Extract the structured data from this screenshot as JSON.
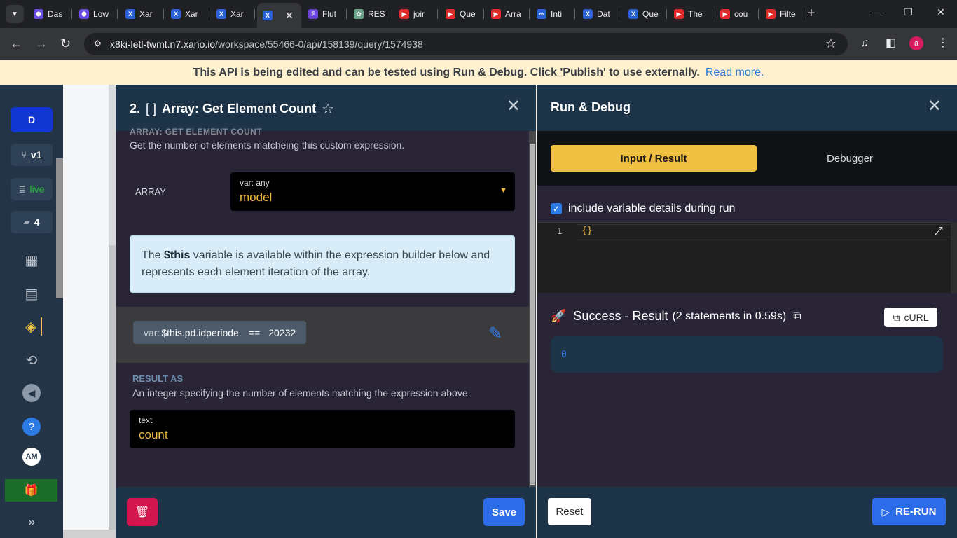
{
  "browser": {
    "tabs": [
      {
        "label": "Das",
        "fav_color": "#6b4ee6",
        "fav_glyph": "⬢"
      },
      {
        "label": "Low",
        "fav_color": "#6b4ee6",
        "fav_glyph": "⬢"
      },
      {
        "label": "Xar",
        "fav_color": "#2a62d6",
        "fav_glyph": "X"
      },
      {
        "label": "Xar",
        "fav_color": "#2a62d6",
        "fav_glyph": "X"
      },
      {
        "label": "Xar",
        "fav_color": "#2a62d6",
        "fav_glyph": "X"
      },
      {
        "label": "",
        "fav_color": "#2a62d6",
        "fav_glyph": "X",
        "active": true
      },
      {
        "label": "Flut",
        "fav_color": "#6a44d8",
        "fav_glyph": "F"
      },
      {
        "label": "RES",
        "fav_color": "#6fa38e",
        "fav_glyph": "✿"
      },
      {
        "label": "joir",
        "fav_color": "#e02b2b",
        "fav_glyph": "▶"
      },
      {
        "label": "Que",
        "fav_color": "#e02b2b",
        "fav_glyph": "▶"
      },
      {
        "label": "Arra",
        "fav_color": "#e02b2b",
        "fav_glyph": "▶"
      },
      {
        "label": "Inti",
        "fav_color": "#2a62d6",
        "fav_glyph": "∞"
      },
      {
        "label": "Dat",
        "fav_color": "#2a62d6",
        "fav_glyph": "X"
      },
      {
        "label": "Que",
        "fav_color": "#2a62d6",
        "fav_glyph": "X"
      },
      {
        "label": "The",
        "fav_color": "#e02b2b",
        "fav_glyph": "▶"
      },
      {
        "label": "cou",
        "fav_color": "#e02b2b",
        "fav_glyph": "▶"
      },
      {
        "label": "Filte",
        "fav_color": "#e02b2b",
        "fav_glyph": "▶"
      }
    ],
    "url_host": "x8ki-letl-twmt.n7.xano.io",
    "url_path": "/workspace/55466-0/api/158139/query/1574938",
    "profile_initial": "a"
  },
  "banner": {
    "message": "This API is being edited and can be tested using Run & Debug. Click 'Publish' to use externally.",
    "link": "Read more."
  },
  "rail": {
    "workspace_initial": "D",
    "version": "v1",
    "env": "live",
    "comments_count": "4",
    "user_initials": "AM"
  },
  "middle": {
    "title_num": "2.",
    "title_icon": "[ ]",
    "title": "Array: Get Element Count",
    "section_label_clipped": "ARRAY: GET ELEMENT COUNT",
    "description": "Get the number of elements matcheing this custom expression.",
    "array_label": "ARRAY",
    "array_type": "var: any",
    "array_value": "model",
    "info_pre": "The ",
    "info_var": "$this",
    "info_post": " variable is available within the expression builder below and represents each element iteration of the array.",
    "expr_prefix": "var:",
    "expr_var": "$this.pd.idperiode",
    "expr_op": "==",
    "expr_value": "20232",
    "result_label": "RESULT AS",
    "result_desc": "An integer specifying the number of elements matching the expression above.",
    "result_type": "text",
    "result_value": "count",
    "save_label": "Save"
  },
  "right": {
    "title": "Run & Debug",
    "tab_input": "Input / Result",
    "tab_debugger": "Debugger",
    "include_label": "include variable details during run",
    "include_checked": true,
    "editor_line": "1",
    "editor_code": "{}",
    "success_title": "Success - Result",
    "success_sub": "(2 statements in 0.59s)",
    "curl_label": "cURL",
    "result_value": "0",
    "reset_label": "Reset",
    "rerun_label": "RE-RUN"
  },
  "colors": {
    "accent_yellow": "#efc041",
    "primary_blue": "#2d6ce8",
    "danger": "#d4164f",
    "header_navy": "#1d3347",
    "body_purple": "#2a2437"
  }
}
